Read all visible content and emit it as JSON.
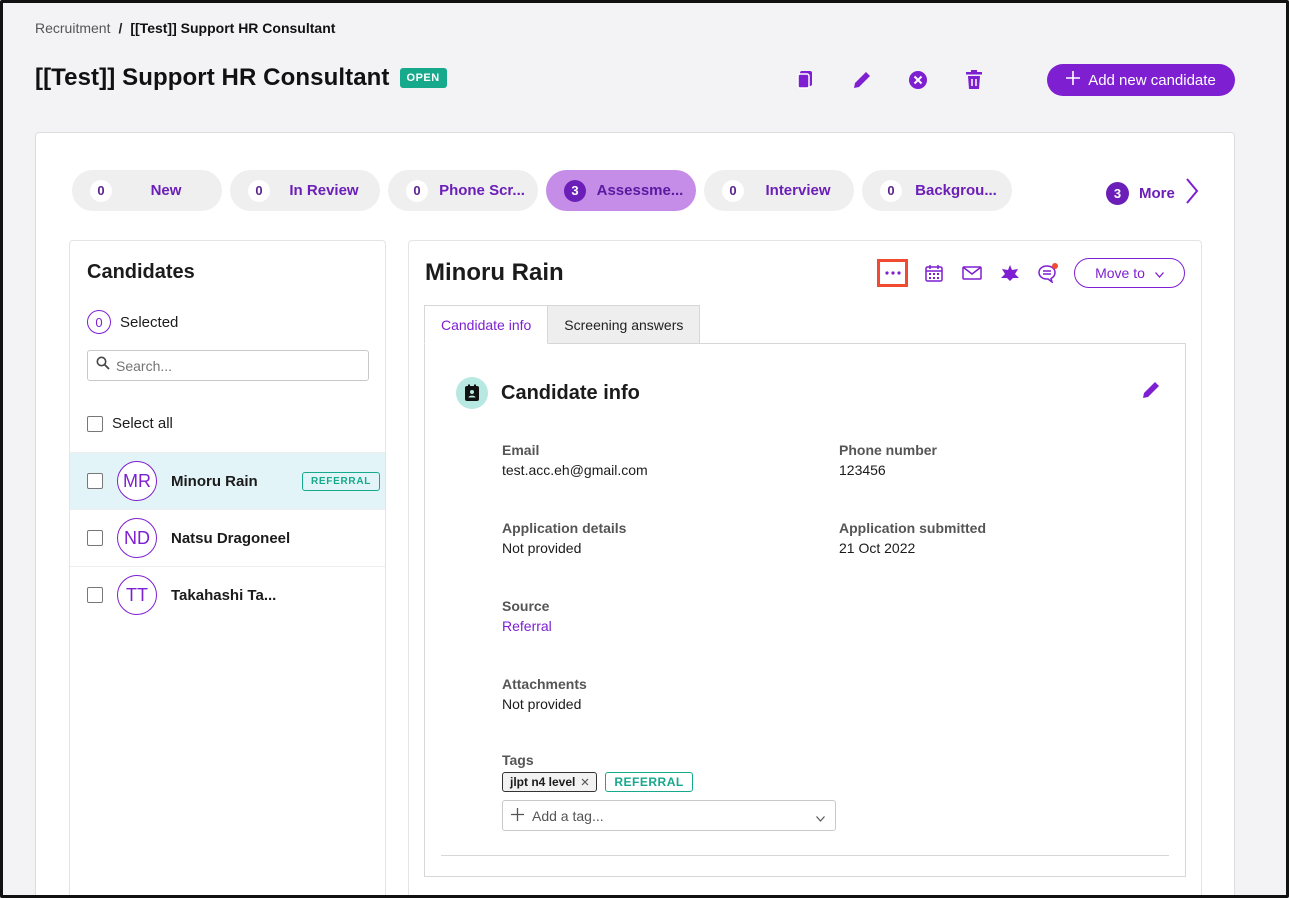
{
  "breadcrumb": {
    "parent": "Recruitment",
    "separator": "/",
    "current": "[[Test]] Support HR Consultant"
  },
  "job": {
    "title": "[[Test]] Support HR Consultant",
    "status": "OPEN"
  },
  "header": {
    "add_candidate_label": "Add new candidate"
  },
  "stages": [
    {
      "count": "0",
      "label": "New"
    },
    {
      "count": "0",
      "label": "In Review"
    },
    {
      "count": "0",
      "label": "Phone Scr..."
    },
    {
      "count": "3",
      "label": "Assessme..."
    },
    {
      "count": "0",
      "label": "Interview"
    },
    {
      "count": "0",
      "label": "Backgrou..."
    }
  ],
  "more": {
    "count": "3",
    "label": "More"
  },
  "candidates_panel": {
    "title": "Candidates",
    "selected_count": "0",
    "selected_label": "Selected",
    "search_placeholder": "Search...",
    "select_all_label": "Select all",
    "items": [
      {
        "initials": "MR",
        "name": "Minoru Rain",
        "badge": "REFERRAL"
      },
      {
        "initials": "ND",
        "name": "Natsu Dragoneel"
      },
      {
        "initials": "TT",
        "name": "Takahashi Ta..."
      }
    ]
  },
  "detail": {
    "name": "Minoru Rain",
    "move_to_label": "Move to",
    "tabs": [
      "Candidate info",
      "Screening answers"
    ],
    "section_title": "Candidate info",
    "fields": {
      "email_label": "Email",
      "email_value": "test.acc.eh@gmail.com",
      "phone_label": "Phone number",
      "phone_value": "123456",
      "app_details_label": "Application details",
      "app_details_value": "Not provided",
      "app_submitted_label": "Application submitted",
      "app_submitted_value": "21 Oct 2022",
      "source_label": "Source",
      "source_value": "Referral",
      "attachments_label": "Attachments",
      "attachments_value": "Not provided",
      "tags_label": "Tags"
    },
    "tags": [
      "jlpt n4 level",
      "REFERRAL"
    ],
    "add_tag_placeholder": "Add a tag..."
  },
  "colors": {
    "accent": "#7e1fd1",
    "open_badge": "#17a98b",
    "active_stage": "#c58de8",
    "active_row": "#e3f4f8",
    "highlight_box": "#f04a30"
  }
}
